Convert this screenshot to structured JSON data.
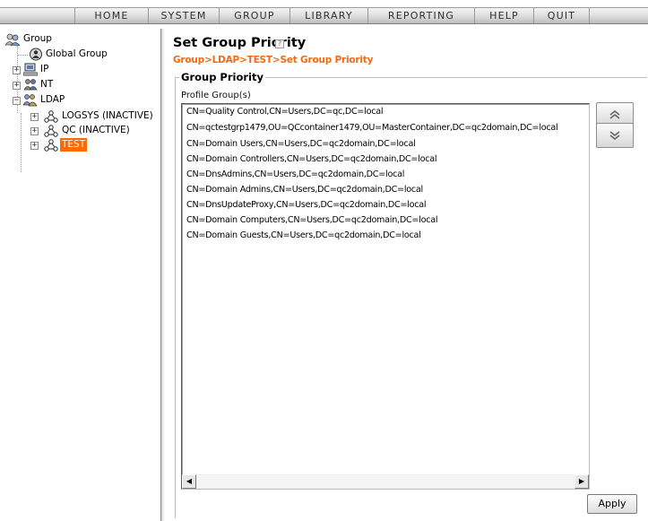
{
  "menu": {
    "items": [
      {
        "label": "HOME"
      },
      {
        "label": "SYSTEM"
      },
      {
        "label": "GROUP"
      },
      {
        "label": "LIBRARY"
      },
      {
        "label": "REPORTING"
      },
      {
        "label": "HELP"
      },
      {
        "label": "QUIT"
      }
    ]
  },
  "tree": {
    "root": {
      "label": "Group",
      "icon": "group-icon"
    },
    "global": {
      "label": "Global Group",
      "icon": "global-group-icon"
    },
    "ip": {
      "label": "IP",
      "icon": "computer-icon"
    },
    "nt": {
      "label": "NT",
      "icon": "users-icon"
    },
    "ldap": {
      "label": "LDAP",
      "icon": "ldap-icon"
    },
    "children": [
      {
        "label": "LOGSYS (INACTIVE)",
        "icon": "network-icon"
      },
      {
        "label": "QC (INACTIVE)",
        "icon": "network-icon"
      },
      {
        "label": "TEST",
        "icon": "network-icon",
        "selected": true
      }
    ],
    "selected_color": "#ff6a00"
  },
  "page": {
    "title": "Set Group Priority",
    "help_icon": "help-icon",
    "breadcrumb": "Group>LDAP>TEST>Set Group Priority",
    "breadcrumb_color": "#f26a10"
  },
  "priority": {
    "legend": "Group Priority",
    "list_label": "Profile Group(s)",
    "rows": [
      "CN=Quality Control,CN=Users,DC=qc,DC=local",
      "CN=qctestgrp1479,OU=QCcontainer1479,OU=MasterContainer,DC=qc2domain,DC=local",
      "CN=Domain Users,CN=Users,DC=qc2domain,DC=local",
      "CN=Domain Controllers,CN=Users,DC=qc2domain,DC=local",
      "CN=DnsAdmins,CN=Users,DC=qc2domain,DC=local",
      "CN=Domain Admins,CN=Users,DC=qc2domain,DC=local",
      "CN=DnsUpdateProxy,CN=Users,DC=qc2domain,DC=local",
      "CN=Domain Computers,CN=Users,DC=qc2domain,DC=local",
      "CN=Domain Guests,CN=Users,DC=qc2domain,DC=local"
    ],
    "move_up_icon": "double-chevron-up-icon",
    "move_down_icon": "double-chevron-down-icon",
    "apply_label": "Apply"
  }
}
